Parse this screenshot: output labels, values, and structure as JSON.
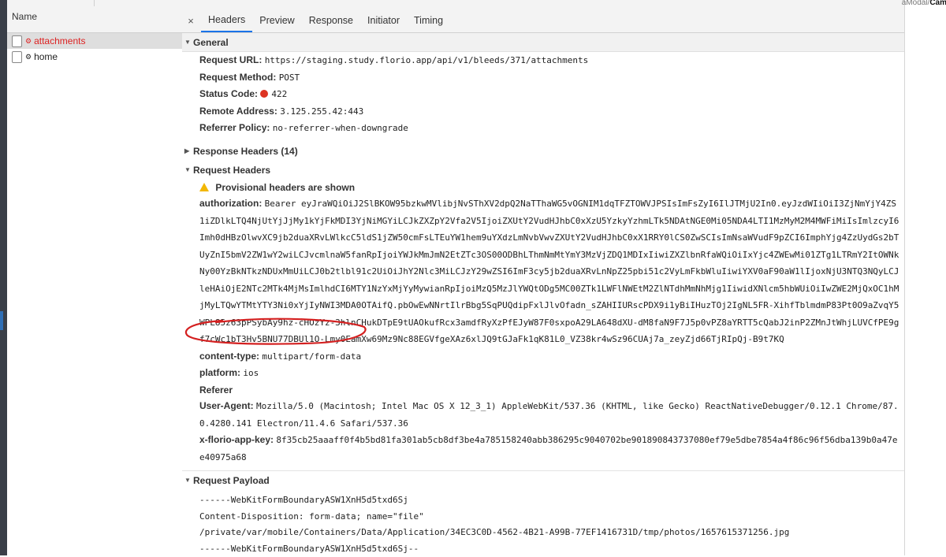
{
  "name_panel": {
    "header": "Name",
    "requests": [
      {
        "name": "attachments",
        "selected": true
      },
      {
        "name": "home",
        "selected": false
      }
    ]
  },
  "tabs": {
    "close_glyph": "×",
    "items": [
      "Headers",
      "Preview",
      "Response",
      "Initiator",
      "Timing"
    ],
    "active": "Headers"
  },
  "right_fragment": {
    "prefix": "aModal/",
    "bold": "Cam"
  },
  "general": {
    "title": "General",
    "request_url": {
      "key": "Request URL:",
      "value": "https://staging.study.florio.app/api/v1/bleeds/371/attachments"
    },
    "request_method": {
      "key": "Request Method:",
      "value": "POST"
    },
    "status_code": {
      "key": "Status Code:",
      "value": "422",
      "color": "#d32f2f"
    },
    "remote_address": {
      "key": "Remote Address:",
      "value": "3.125.255.42:443"
    },
    "referrer_policy": {
      "key": "Referrer Policy:",
      "value": "no-referrer-when-downgrade"
    }
  },
  "response_headers": {
    "title": "Response Headers (14)"
  },
  "request_headers": {
    "title": "Request Headers",
    "provisional": "Provisional headers are shown",
    "authorization": {
      "key": "authorization:",
      "value": "Bearer eyJraWQiOiJ2SlBKOW95bzkwMVlibjNvSThXV2dpQ2NaTThaWG5vOGNIM1dqTFZTOWVJPSIsImFsZyI6IlJTMjU2In0.eyJzdWIiOiI3ZjNmYjY4ZS1iZDlkLTQ4NjUtYjJjMy1kYjFkMDI3YjNiMGYiLCJkZXZpY2Vfa2V5IjoiZXUtY2VudHJhbC0xXzU5YzkyYzhmLTk5NDAtNGE0Mi05NDA4LTI1MzMyM2M4MWFiMiIsImlzcyI6Imh0dHBzOlwvXC9jb2duaXRvLWlkcC5ldS1jZW50cmFsLTEuYW1hem9uYXdzLmNvbVwvZXUtY2VudHJhbC0xX1RRY0lCS0ZwSCIsImNsaWVudF9pZCI6ImphYjg4ZzUydGs2bTUyZnI5bmV2ZW1wY2wiLCJvcmlnaW5fanRpIjoiYWJkMmJmN2EtZTc3OS00ODBhLThmNmMtYmY3MzVjZDQ1MDIxIiwiZXZlbnRfaWQiOiIxYjc4ZWEwMi01ZTg1LTRmY2ItOWNkNy00YzBkNTkzNDUxMmUiLCJ0b2tlbl91c2UiOiJhY2Nlc3MiLCJzY29wZSI6ImF3cy5jb2duaXRvLnNpZ25pbi51c2VyLmFkbWluIiwiYXV0aF90aW1lIjoxNjU3NTQ3NQyLCJleHAiOjE2NTc2MTk4MjMsImlhdCI6MTY1NzYxMjYyMywianRpIjoiMzQ5MzJlYWQtODg5MC00ZTk1LWFlNWEtM2ZlNTdhMmNhMjg1IiwidXNlcm5hbWUiOiIwZWE2MjQxOC1hMjMyLTQwYTMtYTY3Ni0xYjIyNWI3MDA0OTAifQ.pbOwEwNNrtIlrBbg5SqPUQdipFxlJlvOfadn_sZAHIIURscPDX9i1yBiIHuzTOj2IgNL5FR-XihfTblmdmP83Pt0O9aZvqY5WPL85z63pPSybAy9hz-cHOzYz-3hlnCHukDTpE9tUAOkufRcx3amdfRyXzPfEJyW87F0sxpoA29LA648dXU-dM8faN9F7J5p0vPZ8aYRTT5cQabJ2inP2ZMnJtWhjLUVCfPE9gf7cWc1bT3Hv5BNU77DBUl1O-Lmy0EamXw69Mz9Nc88EGVfgeXAz6xlJQ9tGJaFk1qK81L0_VZ38kr4wSz96CUAj7a_zeyZjd66TjRIpQj-B9t7KQ"
    },
    "content_type": {
      "key": "content-type:",
      "value": "multipart/form-data"
    },
    "platform": {
      "key": "platform:",
      "value": "ios"
    },
    "referer": {
      "key": "Referer"
    },
    "user_agent": {
      "key": "User-Agent:",
      "value": "Mozilla/5.0 (Macintosh; Intel Mac OS X 12_3_1) AppleWebKit/537.36 (KHTML, like Gecko) ReactNativeDebugger/0.12.1 Chrome/87.0.4280.141 Electron/11.4.6 Safari/537.36"
    },
    "app_key": {
      "key": "x-florio-app-key:",
      "value": "8f35cb25aaaff0f4b5bd81fa301ab5cb8df3be4a785158240abb386295c9040702be901890843737080ef79e5dbe7854a4f86c96f56dba139b0a47ee40975a68"
    }
  },
  "request_payload": {
    "title": "Request Payload",
    "lines": [
      "------WebKitFormBoundaryASW1XnH5d5txd6Sj",
      "Content-Disposition: form-data; name=\"file\"",
      "",
      "/private/var/mobile/Containers/Data/Application/34EC3C0D-4562-4B21-A99B-77EF1416731D/tmp/photos/1657615371256.jpg",
      "------WebKitFormBoundaryASW1XnH5d5txd6Sj--"
    ]
  },
  "colors": {
    "accent": "#1a73e8",
    "error": "#d32f2f",
    "annotation": "#d42020",
    "warning": "#f2b705"
  }
}
